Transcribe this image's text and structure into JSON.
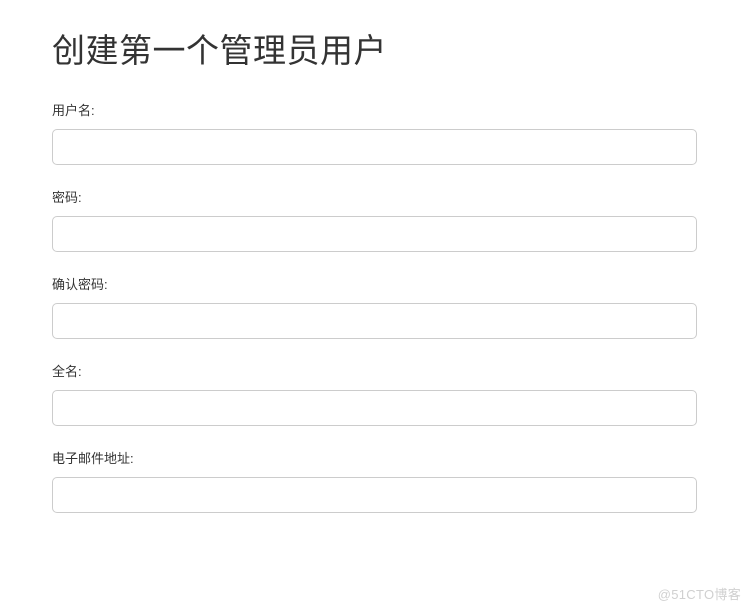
{
  "page": {
    "title": "创建第一个管理员用户"
  },
  "form": {
    "username": {
      "label": "用户名:",
      "value": ""
    },
    "password": {
      "label": "密码:",
      "value": ""
    },
    "confirm_password": {
      "label": "确认密码:",
      "value": ""
    },
    "fullname": {
      "label": "全名:",
      "value": ""
    },
    "email": {
      "label": "电子邮件地址:",
      "value": ""
    }
  },
  "watermark": "@51CTO博客"
}
